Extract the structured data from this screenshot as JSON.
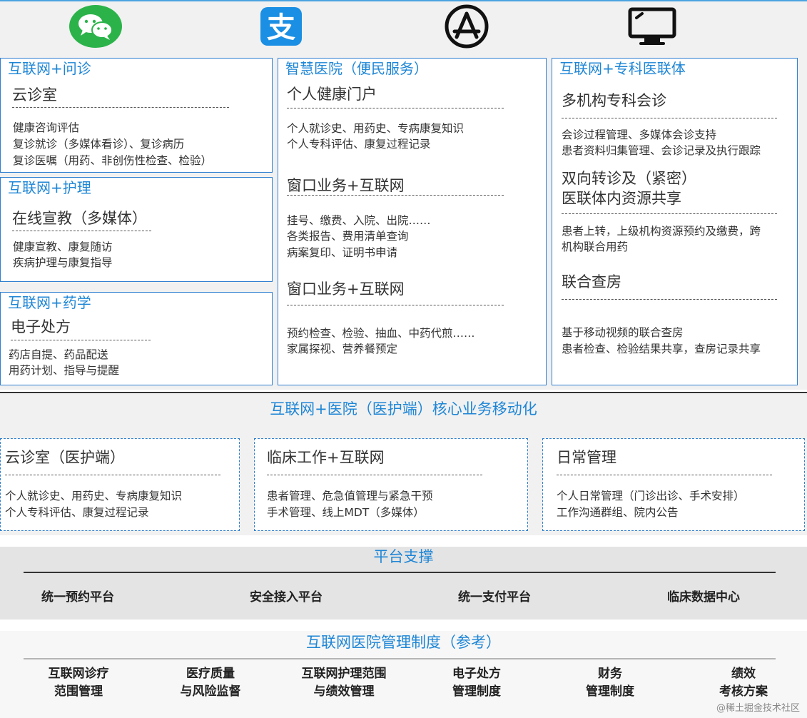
{
  "channels": {
    "icons": [
      "wechat-icon",
      "alipay-icon",
      "app-store-icon",
      "desktop-monitor-icon"
    ],
    "alipay_glyph": "支",
    "colors": {
      "wechat": "#2bb34a",
      "alipay": "#1a8fe3",
      "accent": "#1e86d6"
    }
  },
  "left": {
    "consult": {
      "title": "互联网+问诊",
      "sub": "云诊室",
      "lines": [
        "健康咨询评估",
        "复诊就诊（多媒体看诊）、复诊病历",
        "复诊医嘱（用药、非创伤性检查、检验）"
      ]
    },
    "nursing": {
      "title": "互联网+护理",
      "sub": "在线宣教（多媒体）",
      "lines": [
        "健康宣教、康复随访",
        "疾病护理与康复指导"
      ]
    },
    "pharmacy": {
      "title": "互联网+药学",
      "sub": "电子处方",
      "lines": [
        "药店自提、药品配送",
        "用药计划、指导与提醒"
      ]
    }
  },
  "middle": {
    "title": "智慧医院（便民服务）",
    "sections": [
      {
        "sub": "个人健康门户",
        "lines": [
          "个人就诊史、用药史、专病康复知识",
          "个人专科评估、康复过程记录"
        ]
      },
      {
        "sub": "窗口业务+互联网",
        "lines": [
          "挂号、缴费、入院、出院……",
          "各类报告、费用清单查询",
          "病案复印、证明书申请"
        ]
      },
      {
        "sub": "窗口业务+互联网",
        "lines": [
          "预约检查、检验、抽血、中药代煎……",
          "家属探视、营养餐预定"
        ]
      }
    ]
  },
  "right": {
    "title": "互联网+专科医联体",
    "sections": [
      {
        "sub": "多机构专科会诊",
        "lines": [
          "会诊过程管理、多媒体会诊支持",
          "患者资料归集管理、会诊记录及执行跟踪"
        ]
      },
      {
        "sub_lines": [
          "双向转诊及（紧密）",
          "医联体内资源共享"
        ],
        "lines": [
          "患者上转，上级机构资源预约及缴费，跨",
          "机构联合用药"
        ]
      },
      {
        "sub": "联合查房",
        "lines": [
          "基于移动视频的联合查房",
          "患者检查、检验结果共享，查房记录共享"
        ]
      }
    ]
  },
  "core": {
    "title": "互联网+医院（医护端）核心业务移动化",
    "cards": [
      {
        "sub": "云诊室（医护端）",
        "lines": [
          "个人就诊史、用药史、专病康复知识",
          "个人专科评估、康复过程记录"
        ]
      },
      {
        "sub": "临床工作+互联网",
        "lines": [
          "患者管理、危急值管理与紧急干预",
          "手术管理、线上MDT（多媒体）"
        ]
      },
      {
        "sub": "日常管理",
        "lines": [
          "个人日常管理（门诊出诊、手术安排）",
          "工作沟通群组、院内公告"
        ]
      }
    ]
  },
  "platform": {
    "title": "平台支撑",
    "items": [
      "统一预约平台",
      "安全接入平台",
      "统一支付平台",
      "临床数据中心"
    ]
  },
  "system": {
    "title": "互联网医院管理制度（参考）",
    "items": [
      [
        "互联网诊疗",
        "范围管理"
      ],
      [
        "医疗质量",
        "与风险监督"
      ],
      [
        "互联网护理范围",
        "与绩效管理"
      ],
      [
        "电子处方",
        "管理制度"
      ],
      [
        "财务",
        "管理制度"
      ],
      [
        "绩效",
        "考核方案"
      ]
    ]
  },
  "watermark": "@稀土掘金技术社区"
}
